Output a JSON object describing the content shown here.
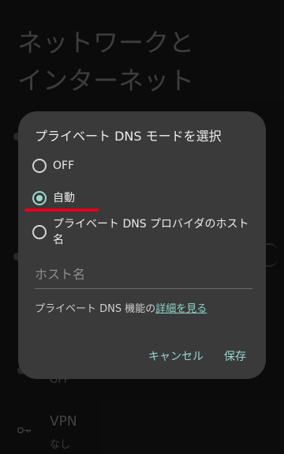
{
  "background": {
    "title_line1": "ネットワークと",
    "title_line2": "インターネット",
    "partial_sub": "OFF",
    "vpn": {
      "title": "VPN",
      "subtitle": "なし",
      "icon": "key-icon"
    }
  },
  "dialog": {
    "title": "プライベート DNS モードを選択",
    "options": [
      {
        "label": "OFF",
        "selected": false
      },
      {
        "label": "自動",
        "selected": true
      },
      {
        "label_line1": "プライベート DNS プロバイダのホスト",
        "label_line2": "名",
        "selected": false
      }
    ],
    "hostname": {
      "placeholder": "ホスト名",
      "value": ""
    },
    "info_prefix": "プライベート DNS 機能の",
    "info_link": "詳細を見る",
    "cancel_label": "キャンセル",
    "save_label": "保存",
    "accent_color": "#9ad8cc",
    "annotation_color": "#e3001b"
  }
}
